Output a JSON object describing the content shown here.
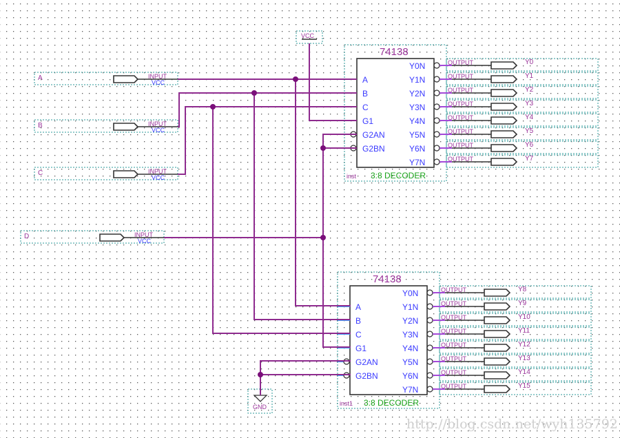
{
  "colors": {
    "wire": "#8e2a8e",
    "pin_stub": "#4aa6ff",
    "pin_text": "#3a3aff",
    "frame": "#2a9a9a",
    "title": "#993399",
    "description": "#19a319"
  },
  "vcc_symbol": {
    "label": "VCC"
  },
  "gnd_symbol": {
    "label": "GND"
  },
  "inputs": [
    {
      "name": "A",
      "type": "INPUT",
      "default": "VCC"
    },
    {
      "name": "B",
      "type": "INPUT",
      "default": "VCC"
    },
    {
      "name": "C",
      "type": "INPUT",
      "default": "VCC"
    },
    {
      "name": "D",
      "type": "INPUT",
      "default": "VCC"
    }
  ],
  "chips": [
    {
      "part": "74138",
      "instance": "inst",
      "description": "3:8 DECODER",
      "input_pins": [
        "A",
        "B",
        "C",
        "G1",
        "G2AN",
        "G2BN"
      ],
      "output_pins": [
        "Y0N",
        "Y1N",
        "Y2N",
        "Y3N",
        "Y4N",
        "Y5N",
        "Y6N",
        "Y7N"
      ],
      "outputs": [
        "Y0",
        "Y1",
        "Y2",
        "Y3",
        "Y4",
        "Y5",
        "Y6",
        "Y7"
      ]
    },
    {
      "part": "74138",
      "instance": "inst1",
      "description": "3:8 DECODER",
      "input_pins": [
        "A",
        "B",
        "C",
        "G1",
        "G2AN",
        "G2BN"
      ],
      "output_pins": [
        "Y0N",
        "Y1N",
        "Y2N",
        "Y3N",
        "Y4N",
        "Y5N",
        "Y6N",
        "Y7N"
      ],
      "outputs": [
        "Y8",
        "Y9",
        "Y10",
        "Y11",
        "Y12",
        "Y13",
        "Y14",
        "Y15"
      ]
    }
  ],
  "output_type": "OUTPUT",
  "watermark": "http://blog.csdn.net/wyh135792"
}
